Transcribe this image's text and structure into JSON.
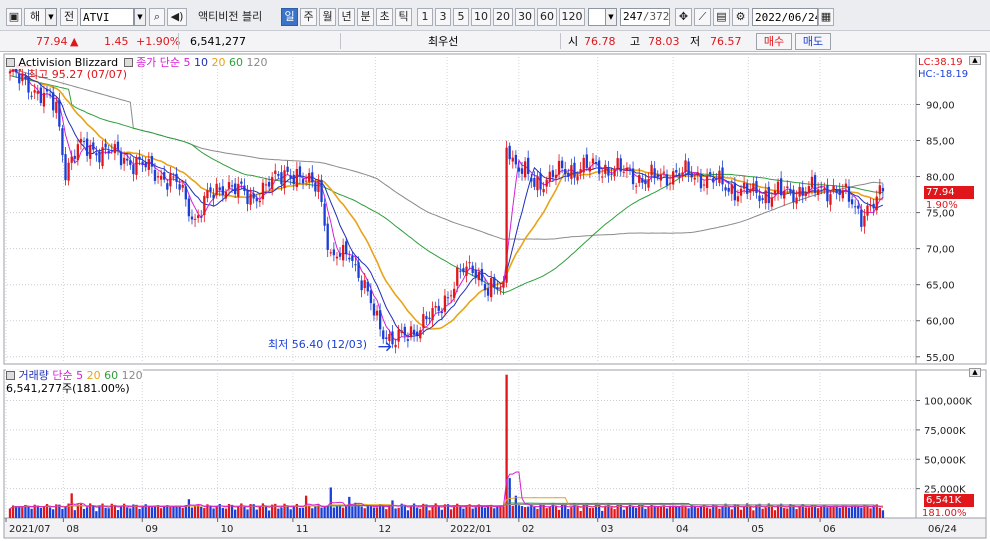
{
  "toolbar": {
    "market_label": "해",
    "prev_label": "전",
    "symbol": "ATVI",
    "name_label": "액티비전 블리",
    "periods": [
      "일",
      "주",
      "월",
      "년",
      "분",
      "초",
      "틱"
    ],
    "active_period": "일",
    "intervals": [
      "1",
      "3",
      "5",
      "10",
      "20",
      "30",
      "60",
      "120"
    ],
    "count_current": "247",
    "count_total": "/372",
    "date": "2022/06/24"
  },
  "quote": {
    "price": "77.94",
    "change_arrow": "▲",
    "change": "1.45",
    "change_pct": "+1.90%",
    "volume": "6,541,277",
    "ask_label": "최우선",
    "open_label": "시",
    "open": "76.78",
    "high_label": "고",
    "high": "78.03",
    "low_label": "저",
    "low": "76.57",
    "buy_label": "매수",
    "sell_label": "매도"
  },
  "price_panel": {
    "title": "Activision Blizzard",
    "ma_label": "종가 단순",
    "ma_periods": [
      "5",
      "10",
      "20",
      "60",
      "120"
    ],
    "high_marker": "최고 95.27 (07/07)",
    "low_marker": "최저 56.40 (12/03)",
    "lc_label": "LC:38.19",
    "hc_label": "HC:-18.19",
    "current_price_tag": "77.94",
    "current_pct_tag": "1.90%"
  },
  "volume_panel": {
    "title": "거래량",
    "ma_label": "단순",
    "ma_periods": [
      "5",
      "20",
      "60",
      "120"
    ],
    "current_volume": "6,541,277주(181.00%)",
    "current_volume_tag": "6,541K",
    "current_pct_tag": "181.00%"
  },
  "colors": {
    "up": "#e0161b",
    "down": "#1b3fd6",
    "ma5": "#d61fd6",
    "ma10": "#1f2fb5",
    "ma20": "#e8a317",
    "ma60": "#2f9e3c",
    "ma120": "#8a8a8a"
  },
  "chart_data": {
    "type": "candlestick",
    "price_axis": {
      "ticks": [
        "90,00",
        "85,00",
        "80,00",
        "75,00",
        "70,00",
        "65,00",
        "60,00",
        "55,00"
      ],
      "ylim": [
        54,
        97
      ]
    },
    "volume_axis": {
      "ticks": [
        "100,000K",
        "75,000K",
        "50,000K",
        "25,000K"
      ],
      "ylim": [
        0,
        126000
      ]
    },
    "x_labels": [
      "2021/07",
      "08",
      "09",
      "10",
      "11",
      "12",
      "2022/01",
      "02",
      "03",
      "04",
      "05",
      "06",
      "06/24"
    ],
    "close_anchors": [
      {
        "x": 0,
        "y": 94.2
      },
      {
        "x": 10,
        "y": 91.5
      },
      {
        "x": 15,
        "y": 89.5
      },
      {
        "x": 18,
        "y": 81
      },
      {
        "x": 22,
        "y": 84
      },
      {
        "x": 32,
        "y": 83.5
      },
      {
        "x": 40,
        "y": 82
      },
      {
        "x": 48,
        "y": 80.5
      },
      {
        "x": 55,
        "y": 78.5
      },
      {
        "x": 60,
        "y": 74
      },
      {
        "x": 64,
        "y": 77
      },
      {
        "x": 70,
        "y": 79
      },
      {
        "x": 78,
        "y": 77
      },
      {
        "x": 86,
        "y": 79.5
      },
      {
        "x": 90,
        "y": 81
      },
      {
        "x": 95,
        "y": 79
      },
      {
        "x": 100,
        "y": 79.5
      },
      {
        "x": 104,
        "y": 68
      },
      {
        "x": 110,
        "y": 70
      },
      {
        "x": 114,
        "y": 65
      },
      {
        "x": 120,
        "y": 59.5
      },
      {
        "x": 124,
        "y": 56.8
      },
      {
        "x": 130,
        "y": 58.5
      },
      {
        "x": 138,
        "y": 61
      },
      {
        "x": 146,
        "y": 66.5
      },
      {
        "x": 151,
        "y": 67.5
      },
      {
        "x": 155,
        "y": 64
      },
      {
        "x": 160,
        "y": 64.5
      },
      {
        "x": 161,
        "y": 85
      },
      {
        "x": 164,
        "y": 81.5
      },
      {
        "x": 170,
        "y": 79
      },
      {
        "x": 178,
        "y": 80.5
      },
      {
        "x": 186,
        "y": 81.3
      },
      {
        "x": 196,
        "y": 81
      },
      {
        "x": 206,
        "y": 79.5
      },
      {
        "x": 216,
        "y": 80.5
      },
      {
        "x": 226,
        "y": 79.8
      },
      {
        "x": 236,
        "y": 78
      },
      {
        "x": 246,
        "y": 77.5
      },
      {
        "x": 256,
        "y": 78
      },
      {
        "x": 266,
        "y": 78.3
      },
      {
        "x": 272,
        "y": 77
      },
      {
        "x": 276,
        "y": 74.8
      },
      {
        "x": 280,
        "y": 75.8
      },
      {
        "x": 283,
        "y": 77.94
      }
    ],
    "volume_spikes": [
      {
        "x": 20,
        "v": 21000
      },
      {
        "x": 58,
        "v": 16000
      },
      {
        "x": 96,
        "v": 19000
      },
      {
        "x": 104,
        "v": 26000
      },
      {
        "x": 110,
        "v": 18000
      },
      {
        "x": 112,
        "v": 13000
      },
      {
        "x": 124,
        "v": 15000
      },
      {
        "x": 161,
        "v": 122000
      },
      {
        "x": 162,
        "v": 34000
      },
      {
        "x": 164,
        "v": 19000
      }
    ]
  }
}
